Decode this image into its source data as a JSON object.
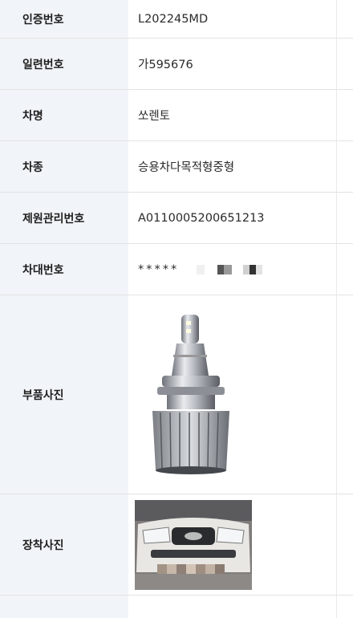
{
  "rows": [
    {
      "label": "인증번호",
      "value": "L202245MD"
    },
    {
      "label": "일련번호",
      "value": "가595676"
    },
    {
      "label": "차명",
      "value": "쏘렌토"
    },
    {
      "label": "차종",
      "value": "승용차다목적형중형"
    },
    {
      "label": "제원관리번호",
      "value": "A011000520065121​3"
    },
    {
      "label": "차대번호",
      "value": "*****"
    },
    {
      "label": "부품사진"
    },
    {
      "label": "장착사진"
    }
  ],
  "icons": {
    "part_photo": "led-headlight-bulb-image",
    "install_photo": "car-front-image"
  }
}
